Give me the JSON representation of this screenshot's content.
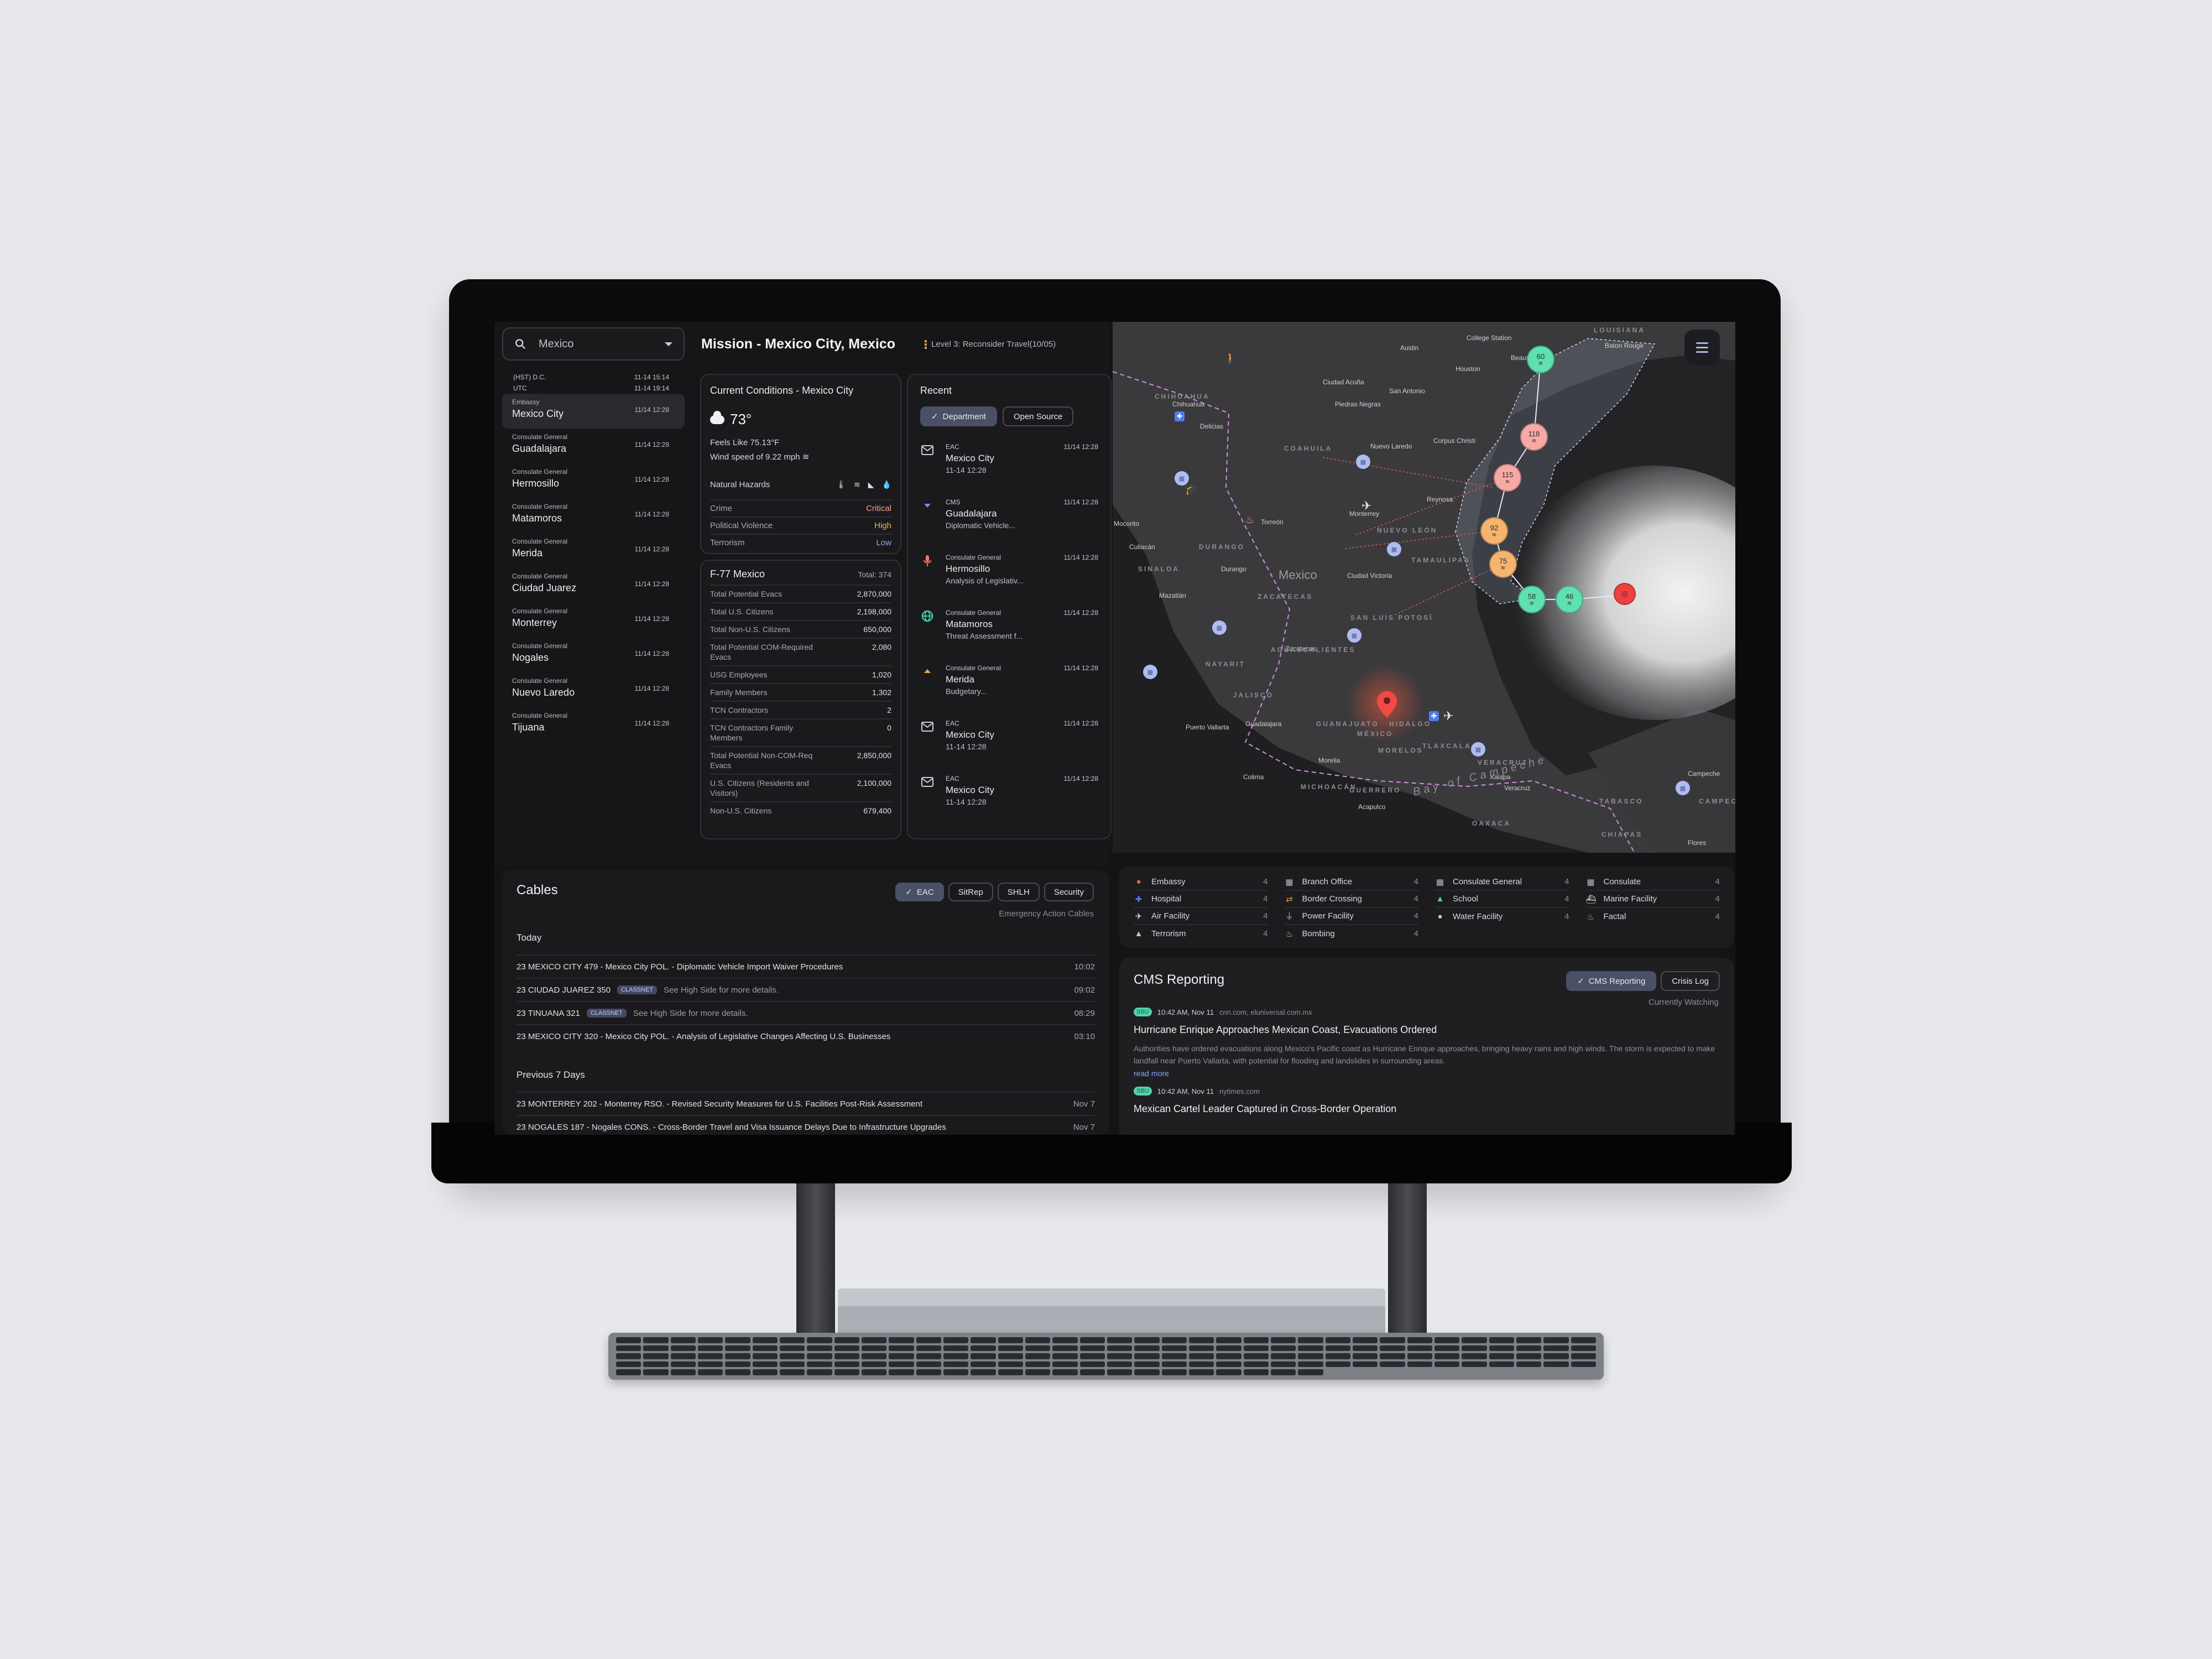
{
  "search": {
    "value": "Mexico",
    "icon": "search-icon"
  },
  "clocks": [
    {
      "label": "(HST) D.C.",
      "time": "11-14 15:14"
    },
    {
      "label": "UTC",
      "time": "11-14 19:14"
    }
  ],
  "locations": [
    {
      "type": "Embassy",
      "name": "Mexico City",
      "time": "11/14 12:28",
      "active": true
    },
    {
      "type": "Consulate General",
      "name": "Guadalajara",
      "time": "11/14 12:28"
    },
    {
      "type": "Consulate General",
      "name": "Hermosillo",
      "time": "11/14 12:28"
    },
    {
      "type": "Consulate General",
      "name": "Matamoros",
      "time": "11/14 12:28"
    },
    {
      "type": "Consulate General",
      "name": "Merida",
      "time": "11/14 12:28"
    },
    {
      "type": "Consulate General",
      "name": "Ciudad Juarez",
      "time": "11/14 12:28"
    },
    {
      "type": "Consulate General",
      "name": "Monterrey",
      "time": "11/14 12:28"
    },
    {
      "type": "Consulate General",
      "name": "Nogales",
      "time": "11/14 12:28"
    },
    {
      "type": "Consulate General",
      "name": "Nuevo Laredo",
      "time": "11/14 12:28"
    },
    {
      "type": "Consulate General",
      "name": "Tijuana",
      "time": "11/14 12:28"
    }
  ],
  "header": {
    "title": "Mission - Mexico City, Mexico",
    "advisory": "Level 3: Reconsider Travel(10/05)",
    "advisory_color": "#e6a23c"
  },
  "conditions": {
    "title": "Current Conditions - Mexico City",
    "temperature": "73°",
    "weather_icon": "cloud-icon",
    "feels_like": "Feels Like 75.13°F",
    "wind": "Wind speed of 9.22 mph",
    "hazards_label": "Natural Hazards",
    "hazard_icons": [
      "heat-icon",
      "wind-icon",
      "landslide-icon",
      "flood-icon"
    ],
    "risks": [
      {
        "label": "Crime",
        "value": "Critical",
        "color": "#f0a08a"
      },
      {
        "label": "Political Violence",
        "value": "High",
        "color": "#f2b25c"
      },
      {
        "label": "Terrorism",
        "value": "Low",
        "color": "#8fa4f0"
      }
    ]
  },
  "f77": {
    "title": "F-77 Mexico",
    "total": "Total: 374",
    "rows": [
      {
        "label": "Total Potential Evacs",
        "value": "2,870,000"
      },
      {
        "label": "Total U.S. Citizens",
        "value": "2,198,000"
      },
      {
        "label": "Total Non-U.S. Citizens",
        "value": "650,000"
      },
      {
        "label": "Total Potential COM-Required Evacs",
        "value": "2,080"
      },
      {
        "label": "USG Employees",
        "value": "1,020"
      },
      {
        "label": "Family Members",
        "value": "1,302"
      },
      {
        "label": "TCN Contractors",
        "value": "2"
      },
      {
        "label": "TCN Contractors Family Members",
        "value": "0"
      },
      {
        "label": "Total Potential Non-COM-Req Evacs",
        "value": "2,850,000"
      },
      {
        "label": "U.S. Citizens (Residents and Visitors)",
        "value": "2,100,000"
      },
      {
        "label": "Non-U.S. Citizens",
        "value": "679,400"
      }
    ]
  },
  "recent": {
    "title": "Recent",
    "filters": [
      {
        "label": "Department",
        "active": true
      },
      {
        "label": "Open Source",
        "active": false
      }
    ],
    "items": [
      {
        "icon": "mail-icon",
        "type": "EAC",
        "title": "Mexico City",
        "sub": "11-14 12:28",
        "time": "11/14 12:28"
      },
      {
        "icon": "arrow-down-icon",
        "type": "CMS",
        "title": "Guadalajara",
        "sub": "Diplomatic Vehicle...",
        "time": "11/14 12:28"
      },
      {
        "icon": "microphone-icon",
        "type": "Consulate General",
        "title": "Hermosillo",
        "sub": "Analysis of Legislativ...",
        "time": "11/14 12:28"
      },
      {
        "icon": "globe-icon",
        "type": "Consulate General",
        "title": "Matamoros",
        "sub": "Threat Assessment f...",
        "time": "11/14 12:28"
      },
      {
        "icon": "arrow-up-icon",
        "type": "Consulate General",
        "title": "Merida",
        "sub": "Budgetary...",
        "time": "11/14 12:28"
      },
      {
        "icon": "mail-icon",
        "type": "EAC",
        "title": "Mexico City",
        "sub": "11-14 12:28",
        "time": "11/14 12:28"
      },
      {
        "icon": "mail-icon",
        "type": "EAC",
        "title": "Mexico City",
        "sub": "11-14 12:28",
        "time": "11/14 12:28"
      }
    ]
  },
  "map": {
    "menu_icon": "menu-icon",
    "region_label": "Mexico",
    "water_label": "Bay of Campeche",
    "cities": [
      "College Station",
      "Austin",
      "Houston",
      "Beaumont",
      "Baton Rouge",
      "San Antonio",
      "Corpus Christi",
      "Ciudad Acuña",
      "Piedras Negras",
      "Nuevo Laredo",
      "Reynosa",
      "Chihuahua",
      "Delicias",
      "Torreón",
      "Monterrey",
      "Mocorito",
      "Culiacán",
      "Durango",
      "Mazatlán",
      "Ciudad Victoria",
      "Zacatecas",
      "Puerto Vallarta",
      "Guadalajara",
      "Colima",
      "Morelia",
      "Xalapa",
      "Veracruz",
      "Acapulco",
      "Campeche",
      "Flores"
    ],
    "states": [
      "LOUISIANA",
      "CHIHUAHUA",
      "COAHUILA",
      "DURANGO",
      "SINALOA",
      "NUEVO LEÓN",
      "TAMAULIPAS",
      "ZACATECAS",
      "SAN LUIS POTOSÍ",
      "AGUASCALIENTES",
      "NAYARIT",
      "JALISCO",
      "GUANAJUATO",
      "MICHOACÁN",
      "MÉXICO",
      "HIDALGO",
      "MORELOS",
      "TLAXCALA",
      "GUERRERO",
      "OAXACA",
      "VERACRUZ",
      "TABASCO",
      "CAMPECHE",
      "CHIAPAS"
    ],
    "storm_track": [
      {
        "wind": "60",
        "color": "#5fe0b0"
      },
      {
        "wind": "118",
        "color": "#f8a9a5"
      },
      {
        "wind": "115",
        "color": "#f8a9a5"
      },
      {
        "wind": "92",
        "color": "#f5b56e"
      },
      {
        "wind": "75",
        "color": "#f5b56e"
      },
      {
        "wind": "58",
        "color": "#5fe0b0"
      },
      {
        "wind": "46",
        "color": "#5fe0b0"
      }
    ],
    "storm_center_icon": "hurricane-icon"
  },
  "cables": {
    "title": "Cables",
    "filters": [
      {
        "label": "EAC",
        "active": true
      },
      {
        "label": "SitRep",
        "active": false
      },
      {
        "label": "SHLH",
        "active": false
      },
      {
        "label": "Security",
        "active": false
      }
    ],
    "subtitle": "Emergency Action Cables",
    "groups": [
      {
        "label": "Today",
        "rows": [
          {
            "title": "23 MEXICO CITY 479 - Mexico City POL. - Diplomatic Vehicle Import Waiver Procedures",
            "badge": "",
            "note": "",
            "time": "10:02"
          },
          {
            "title": "23 CIUDAD JUAREZ 350",
            "badge": "CLASSNET",
            "note": "See High Side for more details.",
            "time": "09:02"
          },
          {
            "title": "23 TINUANA 321",
            "badge": "CLASSNET",
            "note": "See High Side for more details.",
            "time": "08:29"
          },
          {
            "title": "23 MEXICO CITY 320 - Mexico City POL. - Analysis of Legislative Changes Affecting U.S. Businesses",
            "badge": "",
            "note": "",
            "time": "03:10"
          }
        ]
      },
      {
        "label": "Previous 7 Days",
        "rows": [
          {
            "title": "23 MONTERREY 202 - Monterrey RSO. - Revised Security Measures for U.S. Facilities Post-Risk Assessment",
            "badge": "",
            "note": "",
            "time": "Nov 7"
          },
          {
            "title": "23 NOGALES 187 - Nogales CONS. - Cross-Border Travel and Visa Issuance Delays Due to Infrastructure Upgrades",
            "badge": "",
            "note": "",
            "time": "Nov 7"
          }
        ]
      }
    ]
  },
  "legend": [
    {
      "label": "Embassy",
      "count": "4",
      "icon": "map-pin-icon",
      "color": "#f05a4a",
      "glyph": "●"
    },
    {
      "label": "Branch Office",
      "count": "4",
      "icon": "building-icon",
      "color": "#b9bac0",
      "glyph": "▦"
    },
    {
      "label": "Consulate General",
      "count": "4",
      "icon": "building-icon",
      "color": "#b9bac0",
      "glyph": "▦"
    },
    {
      "label": "Consulate",
      "count": "4",
      "icon": "building-icon",
      "color": "#b9bac0",
      "glyph": "▦"
    },
    {
      "label": "Hospital",
      "count": "4",
      "icon": "hospital-icon",
      "color": "#4f7cf0",
      "glyph": "✚"
    },
    {
      "label": "Border Crossing",
      "count": "4",
      "icon": "border-crossing-icon",
      "color": "#e69a3a",
      "glyph": "⇄"
    },
    {
      "label": "School",
      "count": "4",
      "icon": "school-icon",
      "color": "#4fd6a6",
      "glyph": "▲"
    },
    {
      "label": "Marine Facility",
      "count": "4",
      "icon": "ship-icon",
      "color": "#e4e4e8",
      "glyph": "⛴"
    },
    {
      "label": "Air Facility",
      "count": "4",
      "icon": "airplane-icon",
      "color": "#e4e4e8",
      "glyph": "✈"
    },
    {
      "label": "Power Facility",
      "count": "4",
      "icon": "plug-icon",
      "color": "#d9a6f0",
      "glyph": "⏚"
    },
    {
      "label": "Water Facility",
      "count": "4",
      "icon": "water-drop-icon",
      "color": "#c8c9ce",
      "glyph": "●"
    },
    {
      "label": "Factal",
      "count": "4",
      "icon": "fire-icon",
      "color": "#f49a86",
      "glyph": "♨"
    },
    {
      "label": "Terrorism",
      "count": "4",
      "icon": "warning-icon",
      "color": "#c8c9ce",
      "glyph": "▲"
    },
    {
      "label": "Bombing",
      "count": "4",
      "icon": "bomb-icon",
      "color": "#c8c9ce",
      "glyph": "♨"
    }
  ],
  "cms": {
    "title": "CMS Reporting",
    "filters": [
      {
        "label": "CMS Reporting",
        "active": true
      },
      {
        "label": "Crisis Log",
        "active": false
      }
    ],
    "subtitle": "Currently Watching",
    "items": [
      {
        "badge": "SBU",
        "time": "10:42 AM, Nov 11",
        "source": "cnn.com, eluniversal.com.mx",
        "title": "Hurricane Enrique Approaches Mexican Coast, Evacuations Ordered",
        "body": "Authorities have ordered evacuations along Mexico's Pacific coast as Hurricane Enrique approaches, bringing heavy rains and high winds. The storm is expected to make landfall near Puerto Vallarta, with potential for flooding and landslides in surrounding areas.",
        "link": "read more"
      },
      {
        "badge": "SBU",
        "time": "10:42 AM, Nov 11",
        "source": "nytimes.com",
        "title": "Mexican Cartel Leader Captured in Cross-Border Operation",
        "body": "",
        "link": ""
      }
    ]
  }
}
